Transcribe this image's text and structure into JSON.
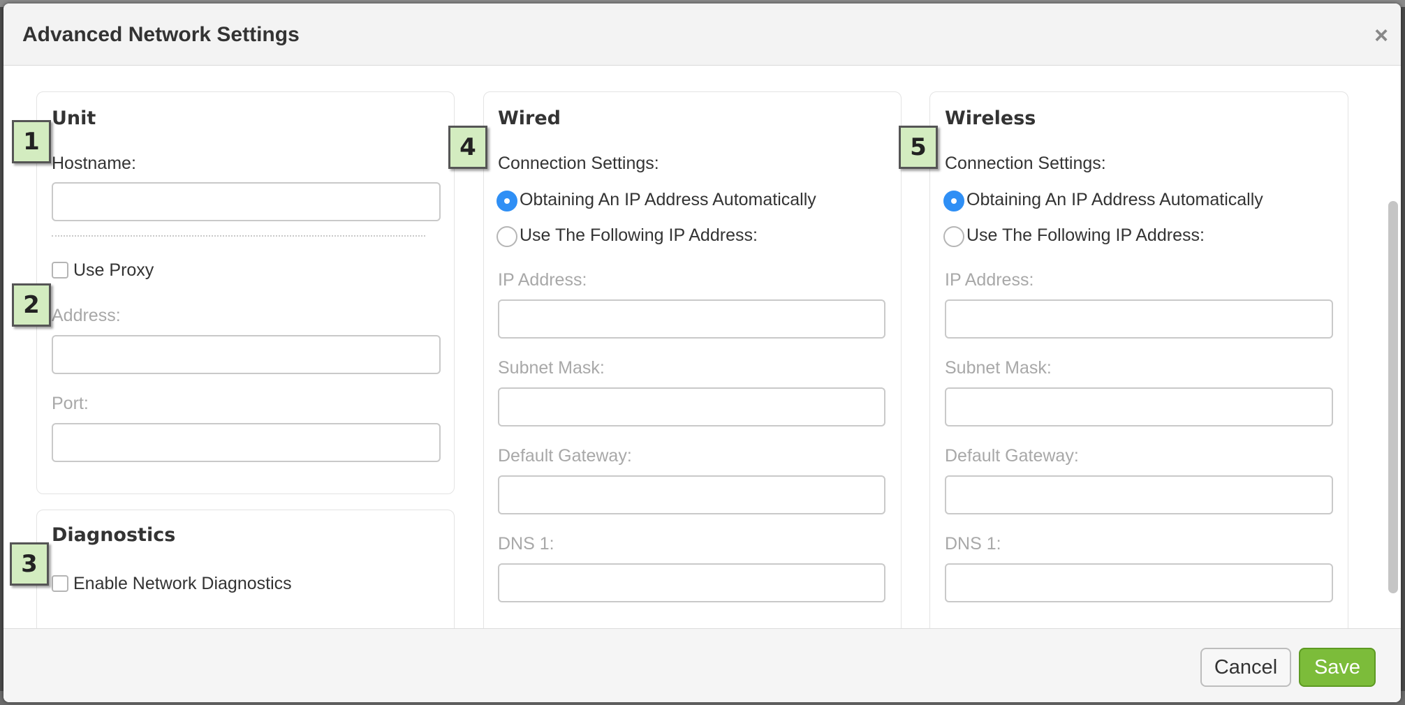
{
  "dialog": {
    "title": "Advanced Network Settings",
    "close_symbol": "×"
  },
  "unit": {
    "title": "Unit",
    "hostname_label": "Hostname:",
    "hostname_value": "",
    "use_proxy_label": "Use Proxy",
    "use_proxy_checked": false,
    "address_label": "Address:",
    "address_value": "",
    "port_label": "Port:",
    "port_value": ""
  },
  "diagnostics": {
    "title": "Diagnostics",
    "enable_label": "Enable Network Diagnostics",
    "enable_checked": false
  },
  "wired": {
    "title": "Wired",
    "connection_settings_label": "Connection Settings:",
    "option_auto": "Obtaining An IP Address Automatically",
    "option_manual": "Use The Following IP Address:",
    "selected": "auto",
    "ip_label": "IP Address:",
    "subnet_label": "Subnet Mask:",
    "gateway_label": "Default Gateway:",
    "dns1_label": "DNS 1:"
  },
  "wireless": {
    "title": "Wireless",
    "connection_settings_label": "Connection Settings:",
    "option_auto": "Obtaining An IP Address Automatically",
    "option_manual": "Use The Following IP Address:",
    "selected": "auto",
    "ip_label": "IP Address:",
    "subnet_label": "Subnet Mask:",
    "gateway_label": "Default Gateway:",
    "dns1_label": "DNS 1:"
  },
  "badges": [
    "1",
    "2",
    "3",
    "4",
    "5"
  ],
  "footer": {
    "cancel_label": "Cancel",
    "save_label": "Save"
  },
  "colors": {
    "radio_selected": "#2f8ff5",
    "save_button": "#7cbc3a",
    "badge_fill": "#d3ecc0"
  }
}
